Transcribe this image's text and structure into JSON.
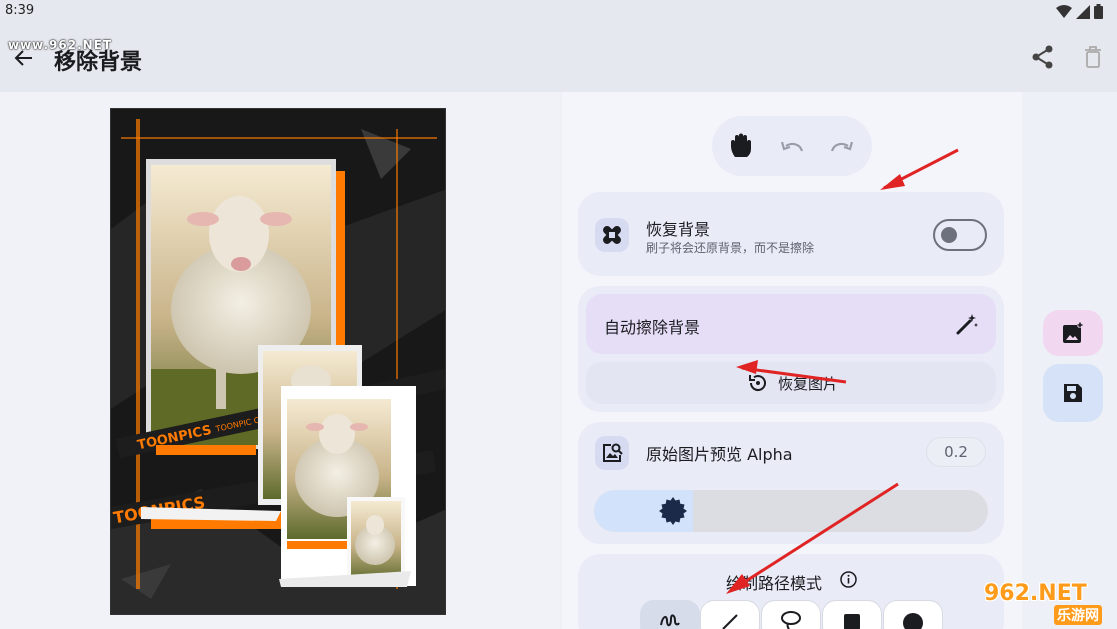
{
  "status_bar": {
    "time": "8:39"
  },
  "watermark_top": "www.962.NET",
  "header": {
    "title": "移除背景"
  },
  "tools": {
    "pan_icon": "hand-icon",
    "undo_icon": "undo-icon",
    "redo_icon": "redo-icon"
  },
  "restore_background": {
    "title": "恢复背景",
    "subtitle": "刷子将会还原背景，而不是擦除",
    "enabled": false
  },
  "auto_erase": {
    "label": "自动擦除背景"
  },
  "restore_image": {
    "label": "恢复图片"
  },
  "alpha_preview": {
    "title": "原始图片预览 Alpha",
    "value": "0.2",
    "level": 0.2
  },
  "draw_mode": {
    "title": "绘制路径模式",
    "modes": [
      "freehand",
      "line",
      "lasso",
      "rect",
      "oval"
    ],
    "selected": "freehand"
  },
  "photo_overlay": {
    "brand_text": "TOONPICS",
    "brand_sub": "TOONPIC CAMERA"
  },
  "watermark": {
    "number": "962.NET",
    "sub": "乐游网"
  },
  "colors": {
    "accent": "#1c2a4a",
    "annotation_arrow": "#e02424",
    "photo_orange": "#ff7a00"
  }
}
